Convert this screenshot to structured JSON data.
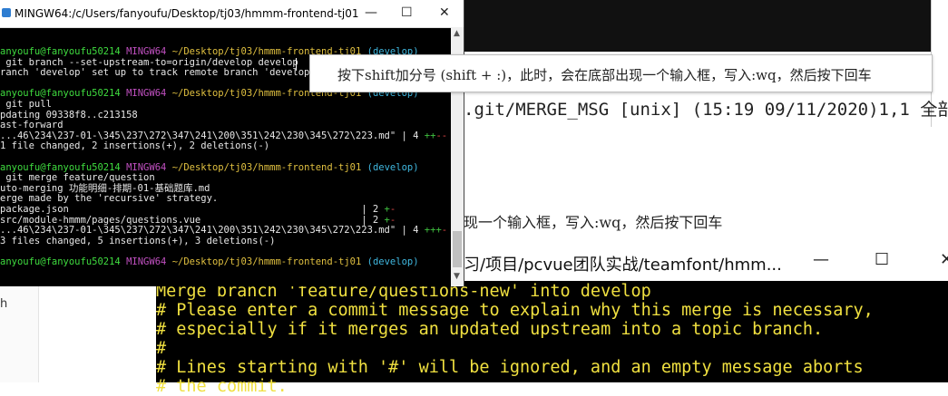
{
  "terminal": {
    "title": "MINGW64:/c/Users/fanyoufu/Desktop/tj03/hmmm-frontend-tj01",
    "controls": {
      "minimize": "—",
      "maximize": "☐",
      "close": "✕"
    },
    "lines": [
      {
        "user": "anyoufu@fanyoufu50214",
        "env": "MINGW64",
        "path": "~/Desktop/tj03/hmmm-frontend-tj01",
        "branch": "(develop)"
      },
      {
        "text": " git branch --set-upstream-to=origin/develop develop"
      },
      {
        "text": "ranch 'develop' set up to track remote branch 'develop'"
      },
      {
        "text": ""
      },
      {
        "user": "anyoufu@fanyoufu50214",
        "env": "MINGW64",
        "path": "~/Desktop/tj03/hmmm-frontend-tj01",
        "branch": "(develop)"
      },
      {
        "text": " git pull"
      },
      {
        "text": "pdating 09338f8..c213158"
      },
      {
        "text": "ast-forward"
      },
      {
        "text": "...46\\234\\237-01-\\345\\237\\272\\347\\241\\200\\351\\242\\230\\345\\272\\223.md\" | 4 ",
        "diff": "++--"
      },
      {
        "text": "1 file changed, 2 insertions(+), 2 deletions(-)"
      },
      {
        "text": ""
      },
      {
        "user": "anyoufu@fanyoufu50214",
        "env": "MINGW64",
        "path": "~/Desktop/tj03/hmmm-frontend-tj01",
        "branch": "(develop)"
      },
      {
        "text": " git merge feature/question"
      },
      {
        "text": "uto-merging 功能明细-排期-01-基础题库.md"
      },
      {
        "text": "erge made by the 'recursive' strategy."
      },
      {
        "text": "package.json                                                   | 2 ",
        "diff": "+-"
      },
      {
        "text": "src/module-hmmm/pages/questions.vue                            | 2 ",
        "diff": "+-"
      },
      {
        "text": "...46\\234\\237-01-\\345\\237\\272\\347\\241\\200\\351\\242\\230\\345\\272\\223.md\" | 4 ",
        "diff": "+++-"
      },
      {
        "text": "3 files changed, 5 insertions(+), 3 deletions(-)"
      },
      {
        "text": ""
      },
      {
        "user": "anyoufu@fanyoufu50214",
        "env": "MINGW64",
        "path": "~/Desktop/tj03/hmmm-frontend-tj01",
        "branch": "(develop)"
      }
    ]
  },
  "tooltip": {
    "text": "按下shift加分号 (shift + :)，此时，会在底部出现一个输入框，写入:wq，然后按下回车"
  },
  "vim_status": ".git/MERGE_MSG [unix] (15:19 09/11/2020)1,1 全部",
  "doc_snippet": "现一个输入框，写入:wq，然后按下回车",
  "second_window": {
    "title": "习/项目/pcvue团队实战/teamfont/hmm...",
    "controls": {
      "minimize": "—",
      "maximize": "☐",
      "close": "✕"
    },
    "lines": [
      "Merge branch 'feature/questions-new' into develop",
      "# Please enter a commit message to explain why this merge is necessary,",
      "# especially if it merges an updated upstream into a topic branch.",
      "#",
      "# Lines starting with '#' will be ignored, and an empty message aborts",
      "# the commit."
    ]
  },
  "left_strip_letter": "h"
}
